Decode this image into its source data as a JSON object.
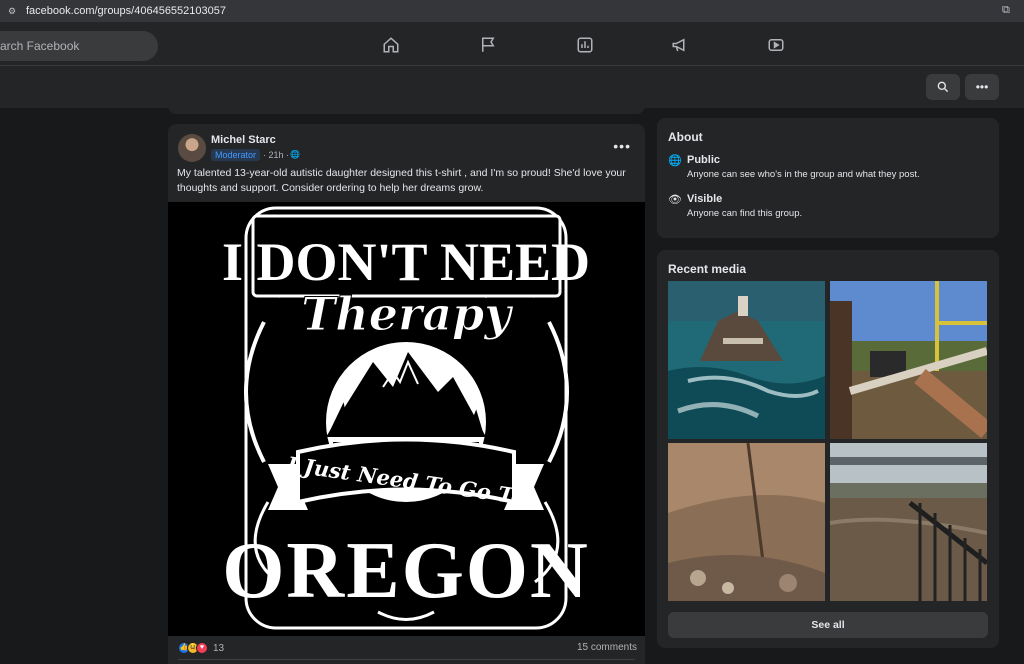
{
  "browser": {
    "url": "facebook.com/groups/406456552103057"
  },
  "topnav": {
    "search_placeholder": "arch Facebook",
    "icons": [
      "home-icon",
      "flag-icon",
      "chart-icon",
      "megaphone-icon",
      "video-icon"
    ]
  },
  "post": {
    "author": "Michel Starc",
    "badge": "Moderator",
    "time": "· 21h ·",
    "text": "My talented 13-year-old autistic daughter designed this t-shirt  , and I'm so proud! She'd love your thoughts and support. Consider ordering to help her dreams grow.",
    "image_lettering": [
      "I DON'T NEED",
      "Therapy",
      "I Just Need To Go To",
      "OREGON"
    ],
    "reaction_count": "13",
    "comments": "15 comments"
  },
  "about": {
    "title": "About",
    "public_title": "Public",
    "public_desc": "Anyone can see who's in the group and what they post.",
    "visible_title": "Visible",
    "visible_desc": "Anyone can find this group."
  },
  "media": {
    "title": "Recent media",
    "see_all": "See all"
  },
  "colors": {
    "accent": "#4599ff",
    "card": "#242526",
    "page": "#18191a"
  }
}
